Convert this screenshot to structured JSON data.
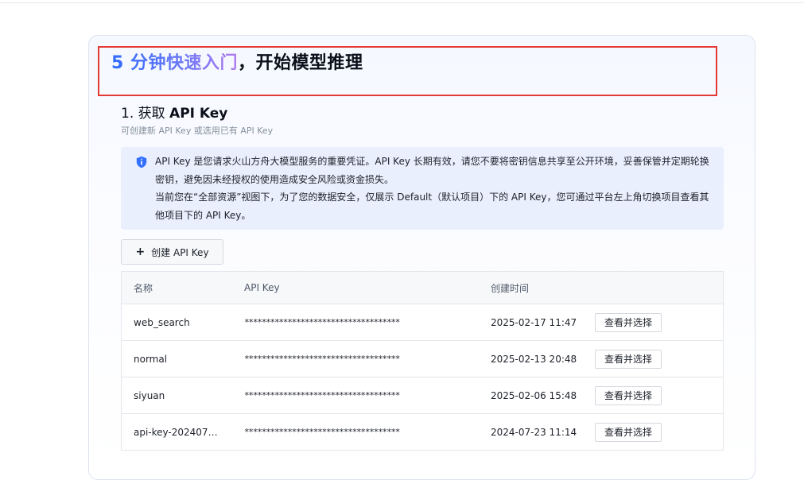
{
  "hero": {
    "title_highlight": "5 分钟快速入门",
    "title_rest": "，开始模型推理"
  },
  "step": {
    "number": "1. ",
    "title_prefix": "获取 ",
    "title_bold": "API Key",
    "subtitle": "可创建新 API Key 或选用已有 API Key"
  },
  "notice": {
    "icon": "shield-info-icon",
    "color": "#3370ff",
    "line1": "API Key 是您请求火山方舟大模型服务的重要凭证。API Key 长期有效，请您不要将密钥信息共享至公开环境，妥善保管并定期轮换密钥，避免因未经授权的使用造成安全风险或资金损失。",
    "line2": "当前您在“全部资源”视图下，为了您的数据安全，仅展示 Default（默认项目）下的 API Key，您可通过平台左上角切换项目查看其他项目下的 API Key。"
  },
  "create_button": {
    "icon": "plus-icon",
    "label": "创建 API Key"
  },
  "table": {
    "headers": {
      "name": "名称",
      "key": "API Key",
      "created": "创建时间"
    },
    "rows": [
      {
        "name": "web_search",
        "key": "************************************",
        "created": "2025-02-17 11:47",
        "action": "查看并选择"
      },
      {
        "name": "normal",
        "key": "************************************",
        "created": "2025-02-13 20:48",
        "action": "查看并选择"
      },
      {
        "name": "siyuan",
        "key": "************************************",
        "created": "2025-02-06 15:48",
        "action": "查看并选择"
      },
      {
        "name": "api-key-2024072…",
        "key": "************************************",
        "created": "2024-07-23 11:14",
        "action": "查看并选择"
      }
    ]
  }
}
